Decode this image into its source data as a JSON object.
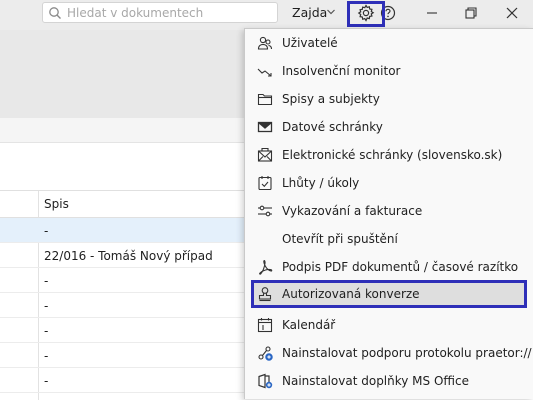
{
  "search": {
    "placeholder": "Hledat v dokumentech"
  },
  "header": {
    "user_name": "Zajda"
  },
  "icons": {
    "search": "search-icon",
    "caret": "chevron-down-icon",
    "settings": "gear-icon",
    "help": "help-icon",
    "minimize": "minimize-icon",
    "restore": "restore-icon",
    "close": "close-icon"
  },
  "colors": {
    "highlight_border": "#2e2fb8",
    "selected_row": "#e4f0fb",
    "hover_item": "#dedede"
  },
  "table": {
    "column_spis": "Spis",
    "rows": [
      "-",
      "22/016 - Tomáš Nový případ",
      "-",
      "-",
      "-",
      "-",
      "-"
    ]
  },
  "menu": {
    "items": [
      {
        "label": "Uživatelé",
        "icon": "users-icon"
      },
      {
        "label": "Insolvenční monitor",
        "icon": "trend-icon"
      },
      {
        "label": "Spisy a subjekty",
        "icon": "folder-icon"
      },
      {
        "label": "Datové schránky",
        "icon": "mailbox-icon"
      },
      {
        "label": "Elektronické schránky (slovensko.sk)",
        "icon": "envelope-icon"
      },
      {
        "label": "Lhůty / úkoly",
        "icon": "task-icon"
      },
      {
        "label": "Vykazování a fakturace",
        "icon": "sliders-icon"
      },
      {
        "label": "Otevřít při spuštění",
        "icon": ""
      },
      {
        "label": "Podpis PDF dokumentů / časové razítko",
        "icon": "pdf-icon"
      },
      {
        "label": "Autorizovaná konverze",
        "icon": "stamp-icon"
      },
      {
        "label": "Kalendář",
        "icon": "calendar-icon"
      },
      {
        "label": "Nainstalovat podporu protokolu praetor://",
        "icon": "protocol-icon"
      },
      {
        "label": "Nainstalovat doplňky MS Office",
        "icon": "office-icon"
      }
    ]
  }
}
